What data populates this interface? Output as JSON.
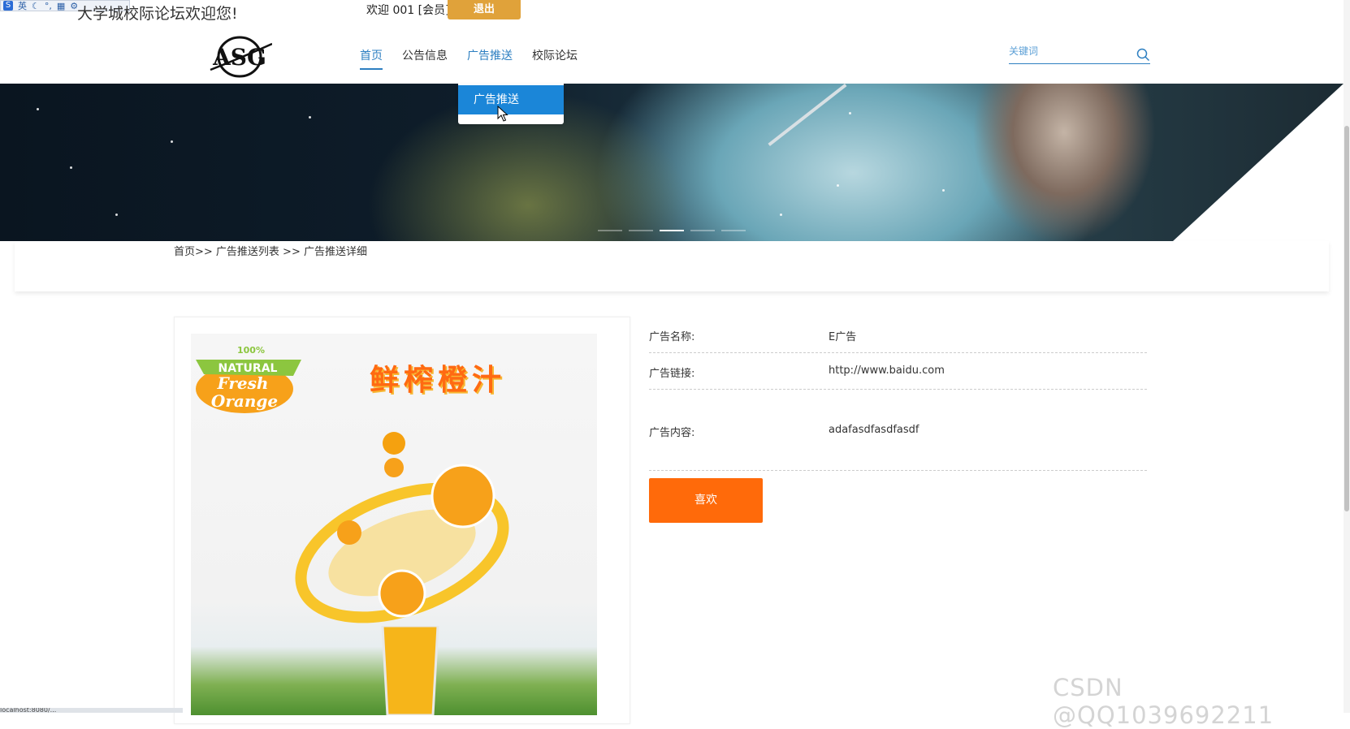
{
  "ime_toolbar": {
    "badge": "S",
    "mode": "英"
  },
  "header": {
    "site_welcome": "大学城校际论坛欢迎您!",
    "user_welcome": "欢迎 001 [会员]",
    "logout_label": "退出",
    "logo_text": "ASG"
  },
  "nav": {
    "items": [
      {
        "label": "首页"
      },
      {
        "label": "公告信息"
      },
      {
        "label": "广告推送"
      },
      {
        "label": "校际论坛"
      }
    ],
    "dropdown": {
      "label": "广告推送"
    }
  },
  "search": {
    "placeholder": "关键词"
  },
  "breadcrumb": "首页>> 广告推送列表 >> 广告推送详细",
  "detail": {
    "name_label": "广告名称:",
    "name_value": "E广告",
    "link_label": "广告链接:",
    "link_value": "http://www.baidu.com",
    "content_label": "广告内容:",
    "content_value": "adafasdfasdfasdf",
    "like_label": "喜欢"
  },
  "poster": {
    "badge_top": "100%",
    "badge_natural": "NATURAL",
    "badge_fresh": "Fresh",
    "badge_orange": "Orange",
    "title": "鲜榨橙汁"
  },
  "watermark": "CSDN @QQ1039692211",
  "status_url": "localhost:8080/..."
}
